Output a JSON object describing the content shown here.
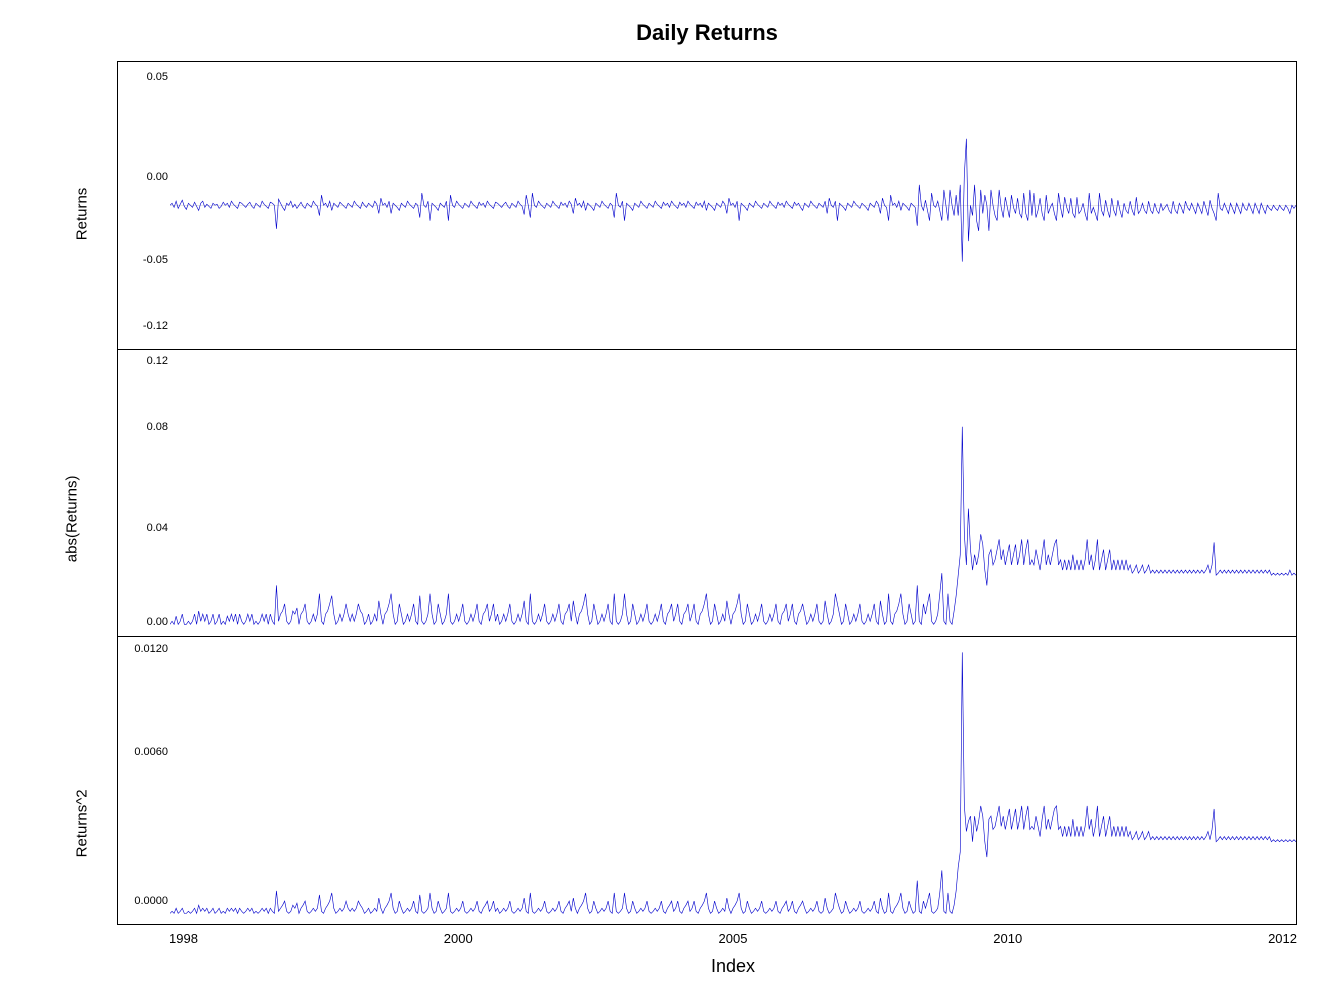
{
  "title": "Daily Returns",
  "x_axis_label": "Index",
  "x_ticks": [
    "1998",
    "2000",
    "2005",
    "2010",
    "2012"
  ],
  "panels": [
    {
      "id": "returns",
      "y_label": "Returns",
      "y_ticks": [
        "0.05",
        "0.00",
        "-0.05",
        "-0.12"
      ],
      "color": "#0000CC",
      "data_description": "returns_series"
    },
    {
      "id": "abs_returns",
      "y_label": "abs(Returns)",
      "y_ticks": [
        "0.12",
        "0.08",
        "0.04",
        "0.00"
      ],
      "color": "#0000CC",
      "data_description": "abs_returns_series"
    },
    {
      "id": "sq_returns",
      "y_label": "Returns^2",
      "y_ticks": [
        "0.0120",
        "0.0060",
        "0.0000"
      ],
      "color": "#0000CC",
      "data_description": "sq_returns_series"
    }
  ],
  "accent_color": "#0000CC"
}
